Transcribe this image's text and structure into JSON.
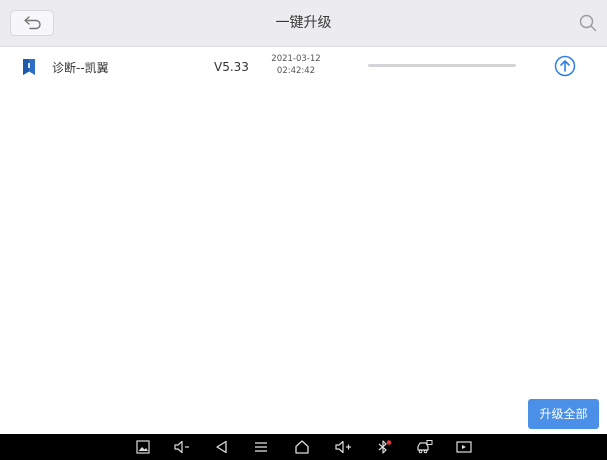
{
  "header": {
    "title": "一键升级",
    "back_icon": "back-arrow-icon",
    "search_icon": "search-icon"
  },
  "update_list": [
    {
      "icon": "bookmark-icon",
      "name": "诊断--凯翼",
      "version": "V5.33",
      "date": "2021-03-12",
      "time": "02:42:42",
      "progress": 0,
      "action_icon": "upload-circle-icon"
    }
  ],
  "footer": {
    "upgrade_all_label": "升级全部"
  },
  "navbar_icons": [
    "screenshot-icon",
    "volume-down-icon",
    "back-icon",
    "menu-icon",
    "home-icon",
    "volume-up-icon",
    "vci-bluetooth-icon",
    "car-diagnostics-icon",
    "screen-record-icon"
  ],
  "colors": {
    "header_bg": "#ececef",
    "accent": "#4a90e8",
    "icon_blue": "#2f7fe0",
    "navbar_bg": "#000000",
    "bluetooth_dot": "#e53935"
  }
}
